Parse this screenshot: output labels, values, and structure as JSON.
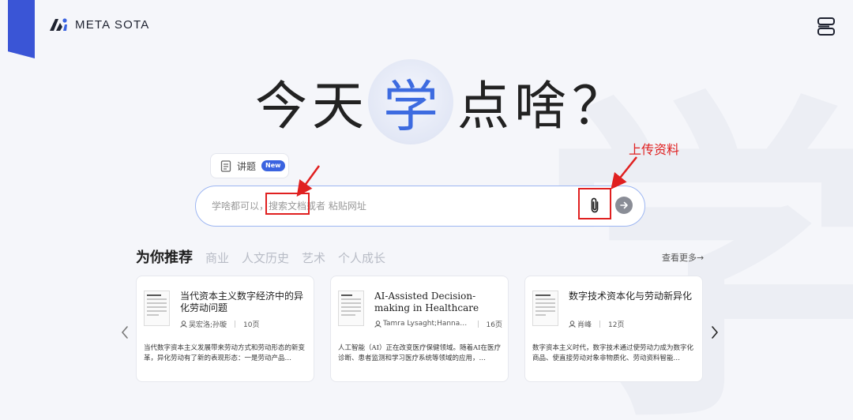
{
  "brand": {
    "name": "META SOTA"
  },
  "hero": {
    "title_before": [
      "今",
      "天"
    ],
    "title_highlight": "学",
    "title_after": [
      "点",
      "啥"
    ],
    "title_question": "？"
  },
  "topic_chip": {
    "label": "讲题",
    "badge": "New"
  },
  "search": {
    "value": "",
    "placeholder": "学啥都可以，搜索文档或者 粘贴网址"
  },
  "annotation": {
    "upload_label": "上传资料"
  },
  "recommend": {
    "title": "为你推荐",
    "tabs": [
      "商业",
      "人文历史",
      "艺术",
      "个人成长"
    ],
    "see_more": "查看更多→",
    "cards": [
      {
        "title": "当代资本主义数字经济中的异化劳动问题",
        "author": "吴宏洛;孙璇",
        "pages": "10页",
        "desc": "当代数字资本主义发展带来劳动方式和劳动形态的新变革，异化劳动有了新的表现形态：一是劳动产品…"
      },
      {
        "title": "AI-Assisted Decision-making in Healthcare",
        "author": "Tamra Lysaght;Hannah …",
        "pages": "16页",
        "desc": "人工智能（AI）正在改变医疗保健领域。随着AI在医疗诊断、患者监测和学习医疗系统等领域的应用，…"
      },
      {
        "title": "数字技术资本化与劳动新异化",
        "author": "肖峰",
        "pages": "12页",
        "desc": "数字资本主义时代，数字技术通过使劳动力成为数字化商品、使直接劳动对象非物质化、劳动资料智能…"
      }
    ]
  },
  "colors": {
    "accent": "#3a63e0",
    "highlight_text": "#3d6be0",
    "annotation": "#e02020"
  },
  "icons": [
    "logo-mark-icon",
    "menu-icon",
    "document-icon",
    "paperclip-icon",
    "arrow-right-icon",
    "user-icon",
    "chevron-left-icon",
    "chevron-right-icon"
  ]
}
